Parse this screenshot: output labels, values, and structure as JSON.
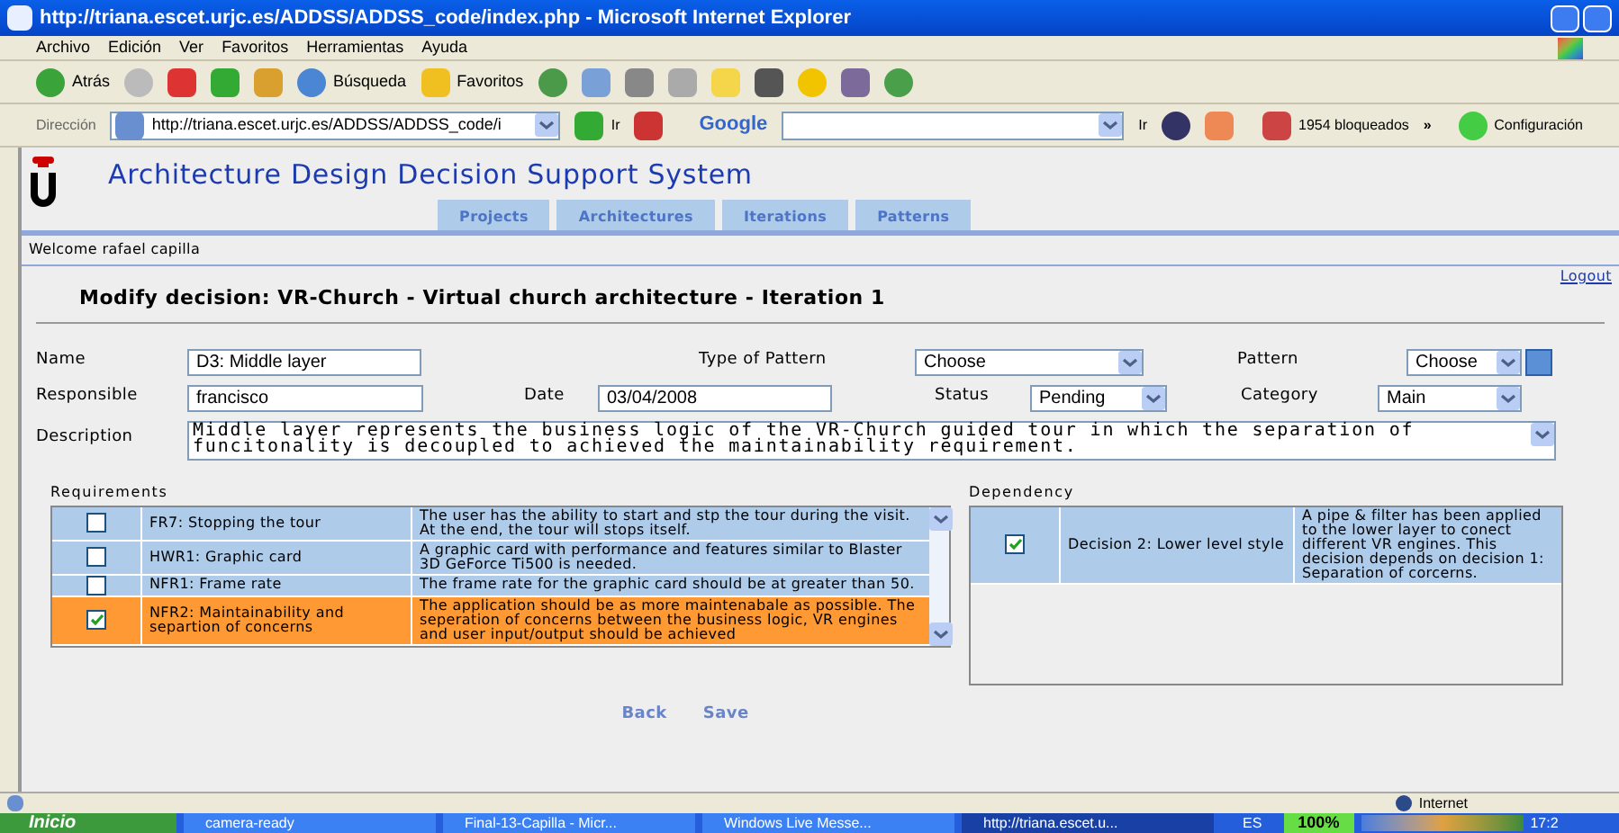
{
  "window": {
    "title": "http://triana.escet.urjc.es/ADDSS/ADDSS_code/index.php - Microsoft Internet Explorer"
  },
  "menu": [
    "Archivo",
    "Edición",
    "Ver",
    "Favoritos",
    "Herramientas",
    "Ayuda"
  ],
  "toolbar": {
    "back": "Atrás",
    "search": "Búsqueda",
    "favorites": "Favoritos"
  },
  "address_bar": {
    "label": "Dirección",
    "url": "http://triana.escet.urjc.es/ADDSS/ADDSS_code/i",
    "go": "Ir",
    "google": "Google",
    "google_go": "Ir",
    "blocked": "1954 bloqueados",
    "more": "»",
    "settings": "Configuración"
  },
  "app": {
    "title": "Architecture Design Decision Support System",
    "tabs": [
      "Projects",
      "Architectures",
      "Iterations",
      "Patterns"
    ],
    "welcome": "Welcome rafael capilla",
    "logout": "Logout",
    "heading": "Modify decision: VR-Church - Virtual church architecture - Iteration 1"
  },
  "form": {
    "name_label": "Name",
    "name": "D3: Middle layer",
    "type_label": "Type of Pattern",
    "type": "Choose",
    "pattern_label": "Pattern",
    "pattern": "Choose",
    "responsible_label": "Responsible",
    "responsible": "francisco",
    "date_label": "Date",
    "date": "03/04/2008",
    "status_label": "Status",
    "status": "Pending",
    "category_label": "Category",
    "category": "Main",
    "description_label": "Description",
    "description": "Middle layer represents the business logic of the VR-Church guided tour in which the separation of funcitonality is decoupled to achieved the maintainability requirement."
  },
  "requirements": {
    "title": "Requirements",
    "rows": [
      {
        "name": "FR7: Stopping the tour",
        "text": "The user has the ability to start and stp the tour during the visit. At the end, the tour will stops itself.",
        "checked": false,
        "selected": false
      },
      {
        "name": "HWR1: Graphic card",
        "text": "A graphic card with performance and features similar to Blaster 3D GeForce Ti500 is needed.",
        "checked": false,
        "selected": false
      },
      {
        "name": "NFR1: Frame rate",
        "text": "The frame rate for the graphic card should be at greater than 50.",
        "checked": false,
        "selected": false
      },
      {
        "name": "NFR2: Maintainability and separtion of concerns",
        "text": "The application should be as more maintenabale as possible. The seperation of concerns between the business logic, VR engines and user input/output should be achieved",
        "checked": true,
        "selected": true
      }
    ]
  },
  "dependency": {
    "title": "Dependency",
    "rows": [
      {
        "name": "Decision 2: Lower level style",
        "text": "A pipe & filter has been applied to the lower layer to conect different VR engines. This decision depends on decision 1: Separation of corcerns.",
        "checked": true,
        "selected": false
      }
    ]
  },
  "actions": [
    "Back",
    "Save"
  ],
  "status_bar": {
    "zone": "Internet"
  },
  "taskbar": {
    "start": "Inicio",
    "tasks": [
      {
        "label": "camera-ready",
        "selected": false
      },
      {
        "label": "Final-13-Capilla - Micr...",
        "selected": false
      },
      {
        "label": "Windows Live Messe...",
        "selected": false
      },
      {
        "label": "http://triana.escet.u...",
        "selected": true
      }
    ],
    "lang": "ES",
    "zoom": "100%",
    "clock": "17:2"
  }
}
